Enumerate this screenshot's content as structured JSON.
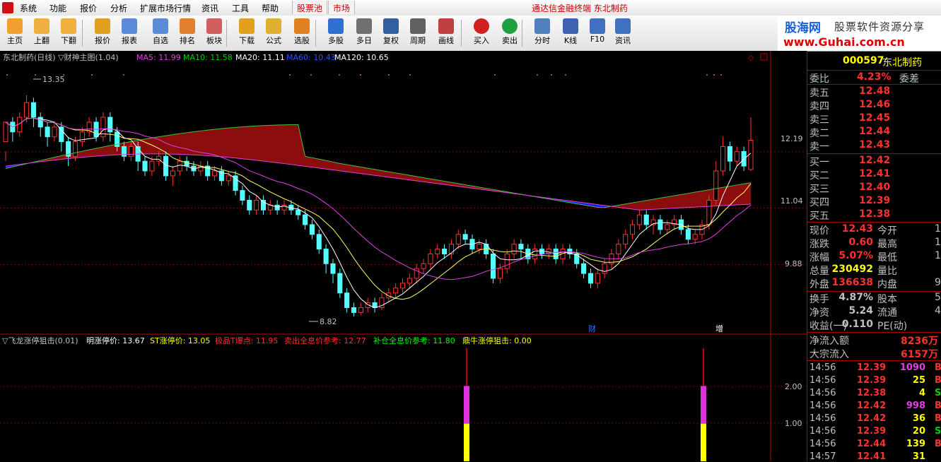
{
  "menu": {
    "items": [
      "系统",
      "功能",
      "报价",
      "分析",
      "扩展市场行情",
      "资讯",
      "工具",
      "帮助"
    ],
    "tab_pool": "股票池",
    "tab_market": "市场",
    "title": "通达信金融终端  东北制药"
  },
  "toolbar": {
    "buttons": [
      {
        "label": "主页",
        "icon": "home-icon"
      },
      {
        "label": "上翻",
        "icon": "arrow-up-icon"
      },
      {
        "label": "下翻",
        "icon": "arrow-down-icon"
      },
      {
        "label": "报价",
        "icon": "yen-icon"
      },
      {
        "label": "报表",
        "icon": "report-icon"
      },
      {
        "label": "自选",
        "icon": "f6-icon"
      },
      {
        "label": "排名",
        "icon": "ranking-icon"
      },
      {
        "label": "板块",
        "icon": "blocks-icon"
      },
      {
        "label": "下载",
        "icon": "download-icon"
      },
      {
        "label": "公式",
        "icon": "formula-icon"
      },
      {
        "label": "选股",
        "icon": "pick-stock-icon"
      },
      {
        "label": "多股",
        "icon": "multi-stock-icon"
      },
      {
        "label": "多日",
        "icon": "clock-icon"
      },
      {
        "label": "复权",
        "icon": "rights-icon"
      },
      {
        "label": "周期",
        "icon": "f8-icon"
      },
      {
        "label": "画线",
        "icon": "draw-line-icon"
      },
      {
        "label": "买入",
        "icon": "buy-icon"
      },
      {
        "label": "卖出",
        "icon": "sell-icon"
      },
      {
        "label": "分时",
        "icon": "timeshare-icon"
      },
      {
        "label": "K线",
        "icon": "kline-icon"
      },
      {
        "label": "F10",
        "icon": "f10-icon"
      },
      {
        "label": "资讯",
        "icon": "news-icon"
      }
    ]
  },
  "logo": {
    "brand": "股海网",
    "slogan": "股票软件资源分享",
    "url": "www.Guhai.com.cn"
  },
  "main_chart": {
    "title": "东北制药(日线) ▽财神主图(1.04)",
    "ma": [
      {
        "label": "MA5: 11.99",
        "color": "#e040e0"
      },
      {
        "label": "MA10: 11.58",
        "color": "#00d000"
      },
      {
        "label": "MA20: 11.11",
        "color": "#ffffff"
      },
      {
        "label": "MA60: 10.43",
        "color": "#3050ff"
      },
      {
        "label": "MA120: 10.65",
        "color": "#ffffff"
      }
    ],
    "high_label": "13.35",
    "low_label": "8.82",
    "y_ticks": [
      "12.19",
      "11.04",
      "9.88"
    ],
    "markers": [
      "财",
      "增"
    ]
  },
  "sub_chart": {
    "title": "▽飞龙涨停狙击(0.01)",
    "items": [
      {
        "label": "明涨停价: 13.67",
        "color": "#ffffff"
      },
      {
        "label": "ST涨停价: 13.05",
        "color": "#ffff00"
      },
      {
        "label": "极品T爆点: 11.95",
        "color": "#ff3030"
      },
      {
        "label": "卖出全息价参考: 12.77",
        "color": "#ff3030"
      },
      {
        "label": "补仓全息价参考: 11.80",
        "color": "#00ff00"
      },
      {
        "label": "鼎牛涨停狙击: 0.00",
        "color": "#ffff00"
      }
    ],
    "y_ticks": [
      "2.00",
      "1.00"
    ]
  },
  "quote": {
    "code": "000597",
    "name": "东北制药",
    "weibi": {
      "label": "委比",
      "value": "4.23%",
      "label2": "委差"
    },
    "sells": [
      {
        "label": "卖五",
        "price": "12.48"
      },
      {
        "label": "卖四",
        "price": "12.46"
      },
      {
        "label": "卖三",
        "price": "12.45"
      },
      {
        "label": "卖二",
        "price": "12.44"
      },
      {
        "label": "卖一",
        "price": "12.43"
      }
    ],
    "buys": [
      {
        "label": "买一",
        "price": "12.42"
      },
      {
        "label": "买二",
        "price": "12.41"
      },
      {
        "label": "买三",
        "price": "12.40"
      },
      {
        "label": "买四",
        "price": "12.39"
      },
      {
        "label": "买五",
        "price": "12.38"
      }
    ],
    "stats": [
      {
        "label": "现价",
        "value": "12.43",
        "label2": "今开",
        "value2": "1",
        "color": "#ff3030"
      },
      {
        "label": "涨跌",
        "value": "0.60",
        "label2": "最高",
        "value2": "1",
        "color": "#ff3030"
      },
      {
        "label": "涨幅",
        "value": "5.07%",
        "label2": "最低",
        "value2": "1",
        "color": "#ff3030"
      },
      {
        "label": "总量",
        "value": "230492",
        "label2": "量比",
        "value2": "",
        "color": "#ffff00"
      },
      {
        "label": "外盘",
        "value": "136638",
        "label2": "内盘",
        "value2": "9",
        "color": "#ff3030"
      },
      {
        "label": "换手",
        "value": "4.87%",
        "label2": "股本",
        "value2": "5.",
        "color": "#c0c0c0"
      },
      {
        "label": "净资",
        "value": "5.24",
        "label2": "流通",
        "value2": "4.",
        "color": "#c0c0c0"
      },
      {
        "label": "收益(一)",
        "value": "0.110",
        "label2": "PE(动)",
        "value2": "",
        "color": "#c0c0c0"
      }
    ],
    "flows": [
      {
        "label": "净流入额",
        "value": "8236万"
      },
      {
        "label": "大宗流入",
        "value": "6157万"
      }
    ],
    "ticks": [
      {
        "time": "14:56",
        "price": "12.39",
        "vol": "1090",
        "side": "B",
        "pc": "#ff3030",
        "vc": "#e040e0",
        "sc": "#ff3030"
      },
      {
        "time": "14:56",
        "price": "12.39",
        "vol": "25",
        "side": "B",
        "pc": "#ff3030",
        "vc": "#ffff00",
        "sc": "#ff3030"
      },
      {
        "time": "14:56",
        "price": "12.38",
        "vol": "4",
        "side": "S",
        "pc": "#ff3030",
        "vc": "#ffff00",
        "sc": "#00d000"
      },
      {
        "time": "14:56",
        "price": "12.42",
        "vol": "998",
        "side": "B",
        "pc": "#ff3030",
        "vc": "#e040e0",
        "sc": "#ff3030"
      },
      {
        "time": "14:56",
        "price": "12.42",
        "vol": "36",
        "side": "B",
        "pc": "#ff3030",
        "vc": "#ffff00",
        "sc": "#ff3030"
      },
      {
        "time": "14:56",
        "price": "12.39",
        "vol": "20",
        "side": "S",
        "pc": "#ff3030",
        "vc": "#ffff00",
        "sc": "#00d000"
      },
      {
        "time": "14:56",
        "price": "12.44",
        "vol": "139",
        "side": "B",
        "pc": "#ff3030",
        "vc": "#ffff00",
        "sc": "#ff3030"
      },
      {
        "time": "14:57",
        "price": "12.41",
        "vol": "31",
        "side": "",
        "pc": "#ff3030",
        "vc": "#ffff00",
        "sc": "#00d000"
      }
    ]
  },
  "chart_data": {
    "type": "candlestick",
    "ylim": [
      8.5,
      14.0
    ],
    "candles": [
      [
        12.4,
        12.8,
        12.2,
        12.0
      ],
      [
        12.8,
        12.6,
        12.9,
        12.4
      ],
      [
        12.6,
        12.9,
        13.0,
        12.5
      ],
      [
        12.9,
        13.2,
        13.35,
        12.8
      ],
      [
        13.2,
        12.9,
        13.3,
        12.7
      ],
      [
        12.9,
        12.7,
        13.0,
        12.5
      ],
      [
        12.7,
        12.5,
        12.8,
        12.3
      ],
      [
        12.5,
        12.7,
        12.8,
        12.4
      ],
      [
        12.7,
        12.4,
        12.8,
        12.2
      ],
      [
        12.4,
        12.1,
        12.5,
        11.9
      ],
      [
        12.1,
        12.4,
        12.5,
        12.0
      ],
      [
        12.4,
        12.6,
        12.7,
        12.3
      ],
      [
        12.6,
        12.8,
        12.9,
        12.5
      ],
      [
        12.8,
        12.5,
        12.9,
        12.4
      ],
      [
        12.5,
        12.9,
        13.0,
        12.4
      ],
      [
        12.9,
        12.6,
        13.0,
        12.4
      ],
      [
        12.6,
        12.3,
        12.7,
        12.2
      ],
      [
        12.3,
        12.1,
        12.4,
        12.0
      ],
      [
        12.1,
        12.3,
        12.4,
        12.0
      ],
      [
        12.3,
        12.0,
        12.4,
        11.8
      ],
      [
        12.0,
        11.8,
        12.1,
        11.7
      ],
      [
        11.8,
        12.0,
        12.1,
        11.7
      ],
      [
        12.0,
        12.1,
        12.2,
        11.9
      ],
      [
        12.1,
        11.7,
        12.2,
        11.6
      ],
      [
        11.7,
        11.8,
        11.9,
        11.5
      ],
      [
        11.8,
        12.0,
        12.1,
        11.7
      ],
      [
        12.0,
        11.9,
        12.1,
        11.8
      ],
      [
        11.9,
        11.8,
        12.0,
        11.7
      ],
      [
        11.8,
        11.9,
        12.0,
        11.7
      ],
      [
        11.9,
        11.7,
        12.0,
        11.6
      ],
      [
        11.7,
        11.8,
        11.9,
        11.6
      ],
      [
        11.8,
        11.6,
        11.9,
        11.5
      ],
      [
        11.6,
        11.7,
        11.8,
        11.5
      ],
      [
        11.7,
        11.4,
        11.8,
        11.3
      ],
      [
        11.4,
        11.2,
        11.5,
        11.1
      ],
      [
        11.2,
        11.0,
        11.3,
        10.9
      ],
      [
        11.0,
        11.2,
        11.3,
        10.9
      ],
      [
        11.2,
        11.0,
        11.3,
        10.9
      ],
      [
        11.0,
        11.1,
        11.2,
        10.9
      ],
      [
        11.1,
        11.0,
        11.2,
        10.9
      ],
      [
        11.0,
        11.1,
        11.2,
        10.9
      ],
      [
        11.1,
        11.0,
        11.2,
        10.9
      ],
      [
        11.0,
        10.9,
        11.1,
        10.8
      ],
      [
        10.9,
        10.7,
        11.0,
        10.6
      ],
      [
        10.7,
        10.5,
        10.8,
        10.4
      ],
      [
        10.5,
        10.2,
        10.6,
        10.1
      ],
      [
        10.2,
        9.9,
        10.3,
        9.7
      ],
      [
        9.9,
        9.7,
        10.0,
        9.5
      ],
      [
        9.7,
        9.3,
        9.8,
        9.2
      ],
      [
        9.3,
        9.0,
        9.4,
        8.9
      ],
      [
        9.0,
        8.9,
        9.1,
        8.82
      ],
      [
        8.9,
        9.0,
        9.1,
        8.85
      ],
      [
        9.0,
        9.1,
        9.2,
        8.9
      ],
      [
        9.1,
        9.0,
        9.2,
        8.9
      ],
      [
        9.0,
        9.2,
        9.3,
        8.95
      ],
      [
        9.2,
        9.3,
        9.4,
        9.1
      ],
      [
        9.3,
        9.4,
        9.5,
        9.2
      ],
      [
        9.4,
        9.5,
        9.6,
        9.3
      ],
      [
        9.5,
        9.6,
        9.7,
        9.4
      ],
      [
        9.6,
        9.8,
        9.9,
        9.5
      ],
      [
        9.8,
        9.9,
        10.0,
        9.7
      ],
      [
        9.9,
        10.1,
        10.2,
        9.8
      ],
      [
        10.1,
        10.2,
        10.3,
        10.0
      ],
      [
        10.2,
        10.1,
        10.3,
        10.0
      ],
      [
        10.1,
        10.3,
        10.4,
        10.0
      ],
      [
        10.3,
        10.5,
        10.6,
        10.2
      ],
      [
        10.5,
        10.4,
        10.6,
        10.3
      ],
      [
        10.4,
        10.2,
        10.5,
        10.1
      ],
      [
        10.2,
        10.3,
        10.4,
        10.1
      ],
      [
        10.3,
        10.1,
        10.4,
        10.0
      ],
      [
        10.1,
        9.6,
        10.2,
        9.5
      ],
      [
        9.6,
        9.8,
        9.9,
        9.5
      ],
      [
        9.8,
        10.1,
        10.2,
        9.7
      ],
      [
        10.1,
        10.3,
        10.4,
        10.0
      ],
      [
        10.3,
        10.2,
        10.4,
        10.0
      ],
      [
        10.2,
        10.0,
        10.3,
        9.9
      ],
      [
        10.0,
        10.2,
        10.3,
        9.9
      ],
      [
        10.2,
        10.1,
        10.3,
        10.0
      ],
      [
        10.1,
        10.2,
        10.3,
        10.0
      ],
      [
        10.2,
        10.0,
        10.3,
        9.9
      ],
      [
        10.0,
        10.2,
        10.3,
        9.9
      ],
      [
        10.2,
        10.1,
        10.3,
        10.0
      ],
      [
        10.1,
        9.9,
        10.2,
        9.8
      ],
      [
        9.9,
        9.7,
        10.0,
        9.6
      ],
      [
        9.7,
        9.5,
        9.8,
        9.4
      ],
      [
        9.5,
        9.7,
        9.8,
        9.4
      ],
      [
        9.7,
        9.9,
        10.0,
        9.6
      ],
      [
        9.9,
        10.1,
        10.2,
        9.8
      ],
      [
        10.1,
        10.3,
        10.4,
        10.0
      ],
      [
        10.3,
        10.5,
        10.6,
        10.2
      ],
      [
        10.5,
        10.7,
        10.8,
        10.4
      ],
      [
        10.7,
        10.9,
        11.0,
        10.6
      ],
      [
        10.9,
        10.7,
        11.0,
        10.6
      ],
      [
        10.7,
        10.8,
        10.9,
        10.5
      ],
      [
        10.8,
        10.6,
        10.9,
        10.5
      ],
      [
        10.6,
        10.7,
        10.8,
        10.5
      ],
      [
        10.7,
        10.8,
        10.9,
        10.6
      ],
      [
        10.8,
        10.6,
        10.9,
        10.5
      ],
      [
        10.6,
        10.4,
        10.7,
        10.3
      ],
      [
        10.4,
        10.5,
        10.6,
        10.3
      ],
      [
        10.5,
        10.7,
        10.8,
        10.4
      ],
      [
        10.7,
        11.2,
        11.3,
        10.6
      ],
      [
        11.2,
        11.8,
        12.0,
        11.1
      ],
      [
        11.8,
        12.3,
        12.5,
        11.7
      ],
      [
        12.3,
        12.0,
        12.4,
        11.8
      ],
      [
        12.0,
        12.2,
        12.3,
        11.9
      ],
      [
        12.2,
        11.9,
        12.3,
        11.8
      ],
      [
        11.83,
        12.43,
        12.9,
        11.8
      ]
    ],
    "sub_bars": [
      {
        "index": 88,
        "red": [
          2.9,
          3.0
        ],
        "magenta": [
          1.0,
          2.0
        ],
        "yellow": [
          0.0,
          1.0
        ]
      },
      {
        "index": 100,
        "red": [
          2.9,
          3.0
        ],
        "magenta": [
          1.0,
          2.0
        ],
        "yellow": [
          0.0,
          1.0
        ]
      }
    ],
    "sub_ylim": [
      0,
      3.0
    ]
  }
}
